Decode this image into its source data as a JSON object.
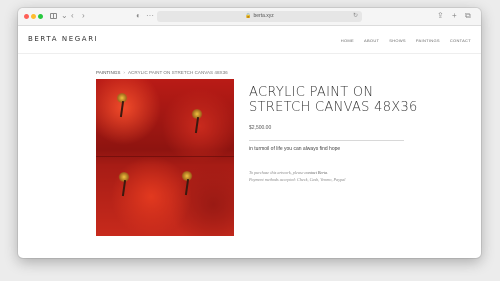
{
  "browser": {
    "url": "berta.xyz",
    "lock_icon": "lock-icon",
    "reload_icon": "reload-icon"
  },
  "site": {
    "logo": "BERTA NEGARI",
    "nav": [
      "HOME",
      "ABOUT",
      "SHOWS",
      "PAINTINGS",
      "CONTACT"
    ]
  },
  "breadcrumb": {
    "parent": "PAINTINGS",
    "separator": "›",
    "current": "ACRYLIC PAINT ON STRETCH CANVAS 48X36"
  },
  "product": {
    "title_line1": "ACRYLIC PAINT ON",
    "title_line2": "STRETCH CANVAS 48X36",
    "price": "$2,500.00",
    "tagline": "in turmoil of life you can always find hope",
    "purchase_line1_prefix": "To purchase this artwork, please ",
    "purchase_link": "contact Berta",
    "purchase_line1_suffix": ".",
    "purchase_line2": "Payment methods accepted: Check, Cash, Venmo, Paypal"
  },
  "colors": {
    "painting_red": "#b91b16",
    "accent_gold": "#f0c341"
  }
}
